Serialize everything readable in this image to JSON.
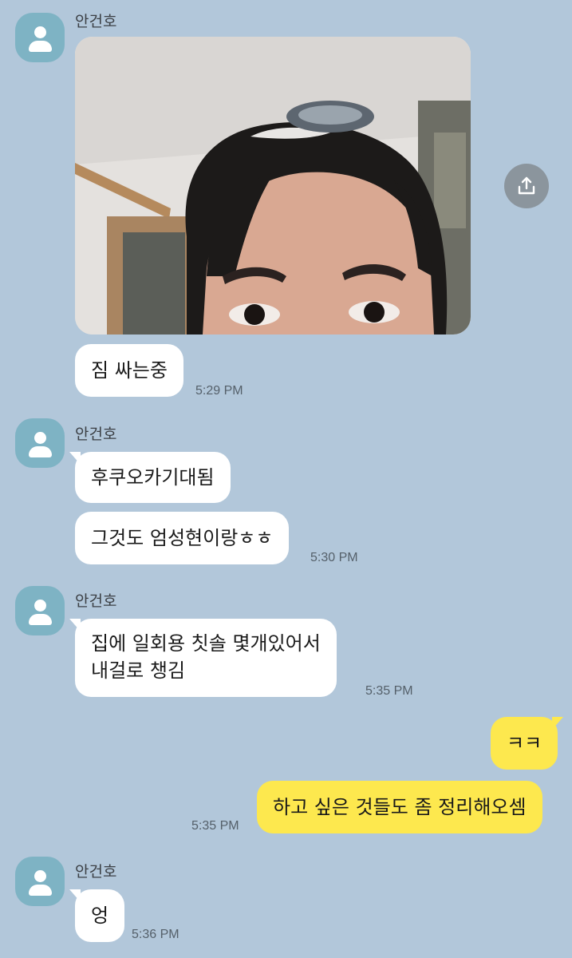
{
  "colors": {
    "background": "#b2c7da",
    "incoming_bubble": "#ffffff",
    "outgoing_bubble": "#fde84e",
    "avatar": "#7eb3c4",
    "share_button": "#8b959d"
  },
  "messages": [
    {
      "sender": "안건호",
      "attachment": "photo",
      "bubbles": [
        "짐 싸는중"
      ],
      "time": "5:29 PM"
    },
    {
      "sender": "안건호",
      "bubbles": [
        "후쿠오카기대됨",
        "그것도 엄성현이랑ㅎㅎ"
      ],
      "time": "5:30 PM"
    },
    {
      "sender": "안건호",
      "bubbles": [
        "집에 일회용 칫솔 몇개있어서\n내걸로 챙김"
      ],
      "time": "5:35 PM"
    },
    {
      "sender": "me",
      "bubbles": [
        "ㅋㅋ",
        "하고 싶은 것들도 좀 정리해오셈"
      ],
      "time": "5:35 PM"
    },
    {
      "sender": "안건호",
      "bubbles": [
        "엉"
      ],
      "time": "5:36 PM"
    }
  ],
  "icons": {
    "avatar": "default-profile-icon",
    "share": "share-upload-icon"
  }
}
